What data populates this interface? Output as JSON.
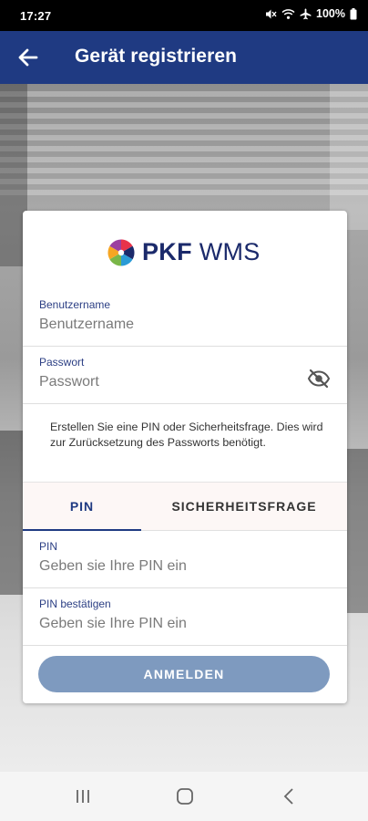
{
  "status_bar": {
    "time": "17:27",
    "battery": "100%"
  },
  "app_bar": {
    "title": "Gerät registrieren"
  },
  "logo": {
    "text_bold": "PKF",
    "text_light": " WMS"
  },
  "form": {
    "username": {
      "label": "Benutzername",
      "placeholder": "Benutzername"
    },
    "password": {
      "label": "Passwort",
      "placeholder": "Passwort"
    },
    "info_text": "Erstellen Sie eine PIN oder Sicherheitsfrage. Dies wird zur Zurücksetzung des Passworts benötigt.",
    "tabs": [
      {
        "label": "PIN",
        "selected": true
      },
      {
        "label": "SICHERHEITSFRAGE",
        "selected": false
      }
    ],
    "pin": {
      "label": "PIN",
      "placeholder": "Geben sie Ihre PIN ein"
    },
    "pin_confirm": {
      "label": "PIN bestätigen",
      "placeholder": "Geben sie Ihre PIN ein"
    },
    "submit_label": "ANMELDEN"
  },
  "colors": {
    "app_bar": "#1f3a82",
    "button_disabled": "#7e9abf",
    "accent": "#1f3a82"
  },
  "icons": {
    "back": "arrow-left-icon",
    "password_toggle": "eye-off-icon"
  }
}
